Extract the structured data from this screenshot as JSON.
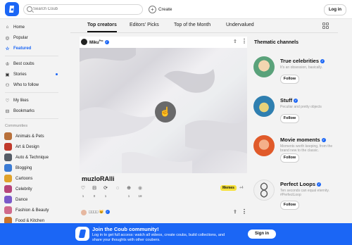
{
  "header": {
    "search_placeholder": "Search Coub",
    "create_label": "Create",
    "login_label": "Log in"
  },
  "sidebar": {
    "nav": [
      {
        "label": "Home",
        "icon": "home-icon"
      },
      {
        "label": "Popular",
        "icon": "popular-icon"
      },
      {
        "label": "Featured",
        "icon": "star-icon",
        "active": true
      },
      {
        "label": "Best coubs",
        "icon": "trophy-icon"
      },
      {
        "label": "Stories",
        "icon": "stories-icon",
        "badge_dot": true
      },
      {
        "label": "Who to follow",
        "icon": "who-to-follow-icon"
      }
    ],
    "personal": [
      {
        "label": "My likes",
        "icon": "heart-icon"
      },
      {
        "label": "Bookmarks",
        "icon": "bookmark-icon"
      }
    ],
    "communities_header": "Communities",
    "communities": [
      {
        "label": "Animals & Pets",
        "color": "#b8703a"
      },
      {
        "label": "Art & Design",
        "color": "#c0392b"
      },
      {
        "label": "Auto & Technique",
        "color": "#555c66"
      },
      {
        "label": "Blogging",
        "color": "#3b7bd4"
      },
      {
        "label": "Cartoons",
        "color": "#e0a22a"
      },
      {
        "label": "Celebrity",
        "color": "#b6457a"
      },
      {
        "label": "Dance",
        "color": "#7a59c9"
      },
      {
        "label": "Fashion & Beauty",
        "color": "#d06a8b"
      },
      {
        "label": "Food & Kitchen",
        "color": "#c8742e"
      }
    ]
  },
  "tabs": [
    {
      "label": "Top creators",
      "active": true
    },
    {
      "label": "Editors' Picks"
    },
    {
      "label": "Top of the Month"
    },
    {
      "label": "Undervalued"
    }
  ],
  "coub": {
    "author": "Miku",
    "author_suffix": "Pro",
    "title": "muzloRAlli",
    "tags": [
      "Memes"
    ],
    "more_tags": "+4",
    "counts": {
      "like": "1",
      "bookmark": "0",
      "recoub": "1",
      "send": "1",
      "views": "18"
    }
  },
  "second_coub": {
    "author": "□□□□ 😺"
  },
  "thematic": {
    "title": "Thematic channels",
    "follow_label": "Follow",
    "channels": [
      {
        "name": "True celebrities",
        "description": "It's an obsession, basically.",
        "color": "#5aa27a"
      },
      {
        "name": "Stuff",
        "description": "Peculiar and pretty objects",
        "color": "#2f7fb0"
      },
      {
        "name": "Movie moments",
        "description": "Moments worth keeping, from the brand new to the classic.",
        "color": "#e05a2a"
      },
      {
        "name": "Perfect Loops",
        "description": "Ten seconds can equal eternity. #PerfectLoop",
        "color": "#dcdcdc"
      }
    ]
  },
  "banner": {
    "title": "Join the Coub community!",
    "description": "Log in to get full access: watch all videos, create coubs, build collections, and share your thoughts with other coubers.",
    "signin_label": "Sign in"
  }
}
